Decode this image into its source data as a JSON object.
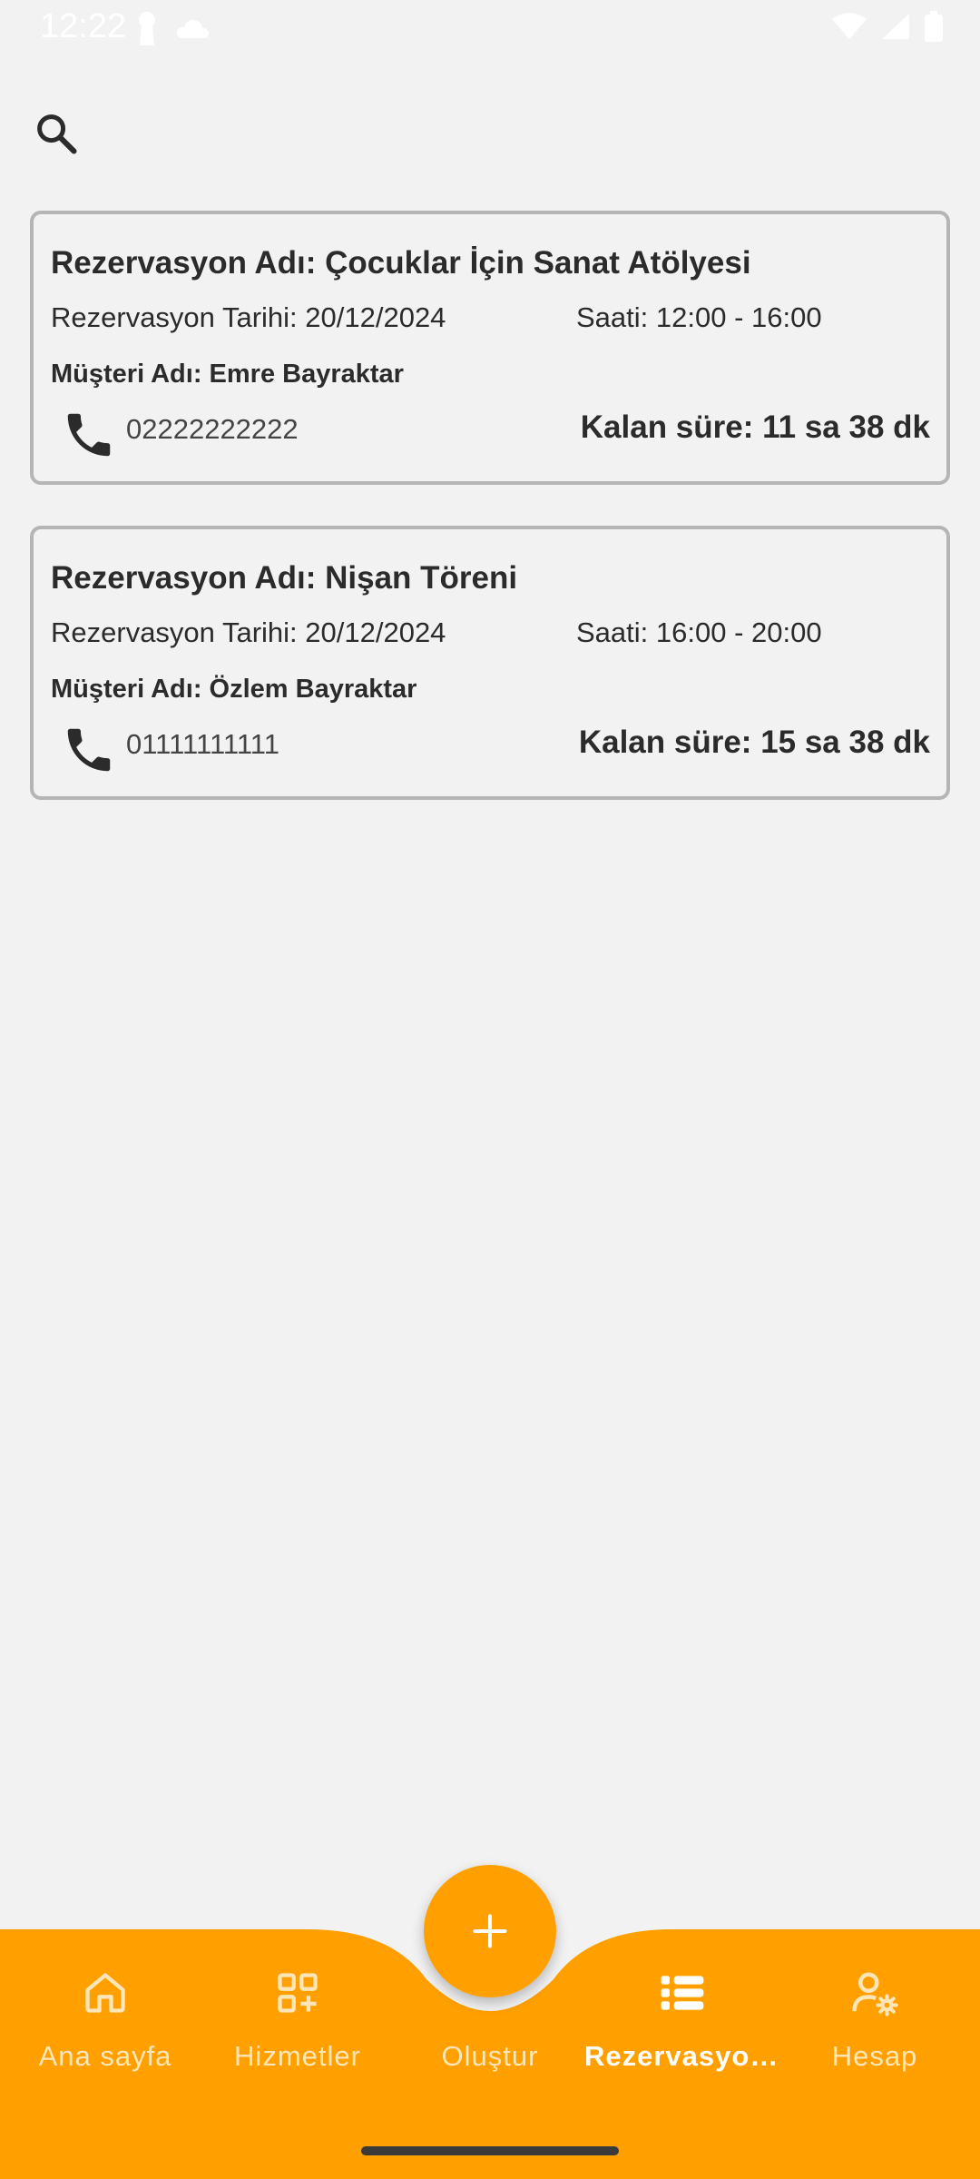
{
  "status_bar": {
    "time": "12:22",
    "left_icons": [
      "keyhole-icon",
      "cloud-icon"
    ],
    "right_icons": [
      "wifi-icon",
      "signal-icon",
      "battery-icon"
    ]
  },
  "search": {
    "icon": "search-icon"
  },
  "reservations": [
    {
      "title": "Rezervasyon Adı: Çocuklar İçin Sanat Atölyesi",
      "date": "Rezervasyon Tarihi: 20/12/2024",
      "time": "Saati: 12:00 - 16:00",
      "customer": "Müşteri Adı: Emre Bayraktar",
      "phone": "02222222222",
      "remaining": "Kalan süre: 11 sa 38 dk"
    },
    {
      "title": "Rezervasyon Adı: Nişan Töreni",
      "date": "Rezervasyon Tarihi: 20/12/2024",
      "time": "Saati: 16:00 - 20:00",
      "customer": "Müşteri Adı: Özlem Bayraktar",
      "phone": "01111111111",
      "remaining": "Kalan süre: 15 sa 38 dk"
    }
  ],
  "bottom_nav": {
    "items": [
      {
        "label": "Ana sayfa",
        "icon": "home-icon",
        "active": false
      },
      {
        "label": "Hizmetler",
        "icon": "services-grid-icon",
        "active": false
      },
      {
        "label": "Oluştur",
        "icon": "plus-icon",
        "active": false
      },
      {
        "label": "Rezervasyonlar",
        "icon": "list-icon",
        "active": true
      },
      {
        "label": "Hesap",
        "icon": "account-settings-icon",
        "active": false
      }
    ],
    "fab_icon": "plus-icon"
  },
  "colors": {
    "accent": "#ffa000",
    "background": "#f2f2f2",
    "card_border": "#b5b5b5",
    "text": "#2b2b2b",
    "nav_label_inactive": "#ffe6b8",
    "nav_label_active": "#ffffff"
  }
}
